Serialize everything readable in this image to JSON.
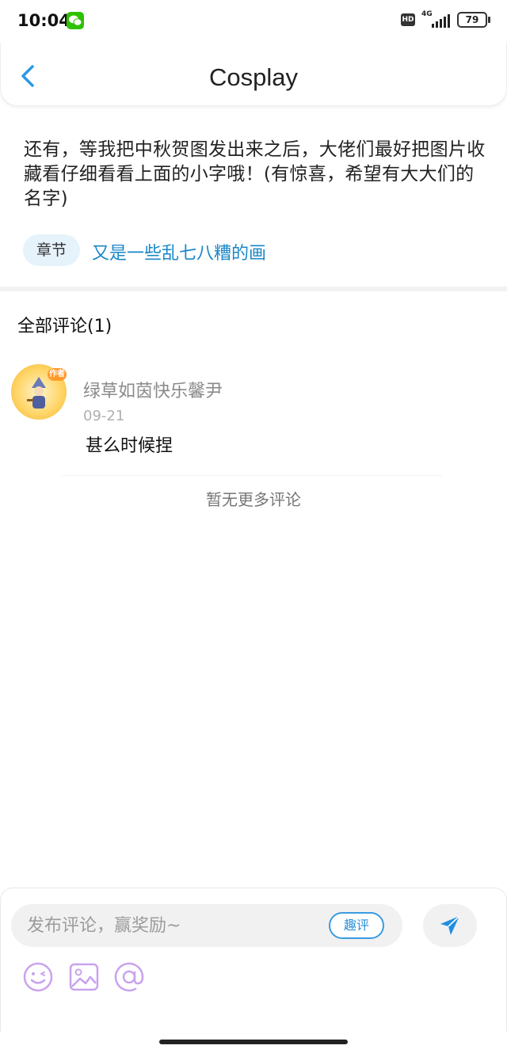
{
  "status_bar": {
    "time": "10:04",
    "hd_label": "HD",
    "network": "4G",
    "battery": "79"
  },
  "header": {
    "title": "Cosplay"
  },
  "post": {
    "text": "还有，等我把中秋贺图发出来之后，大佬们最好把图片收藏看仔细看看上面的小字哦！(有惊喜，希望有大大们的名字)",
    "chapter_tag": "章节",
    "chapter_title": "又是一些乱七八糟的画"
  },
  "comments": {
    "header": "全部评论(1)",
    "items": [
      {
        "user": "绿草如茵快乐馨尹",
        "date": "09-21",
        "text": "甚么时候捏",
        "badge": "作者"
      }
    ],
    "no_more": "暂无更多评论"
  },
  "composer": {
    "placeholder": "发布评论，赢奖励~",
    "fun_review": "趣评"
  },
  "icons": {
    "back": "chevron-left-icon",
    "send": "send-icon",
    "emoji": "emoji-icon",
    "image": "image-icon",
    "mention": "at-icon"
  },
  "colors": {
    "accent": "#1a87c8",
    "send": "#1e8fe3",
    "tool_icons": "#c9a3ee"
  }
}
